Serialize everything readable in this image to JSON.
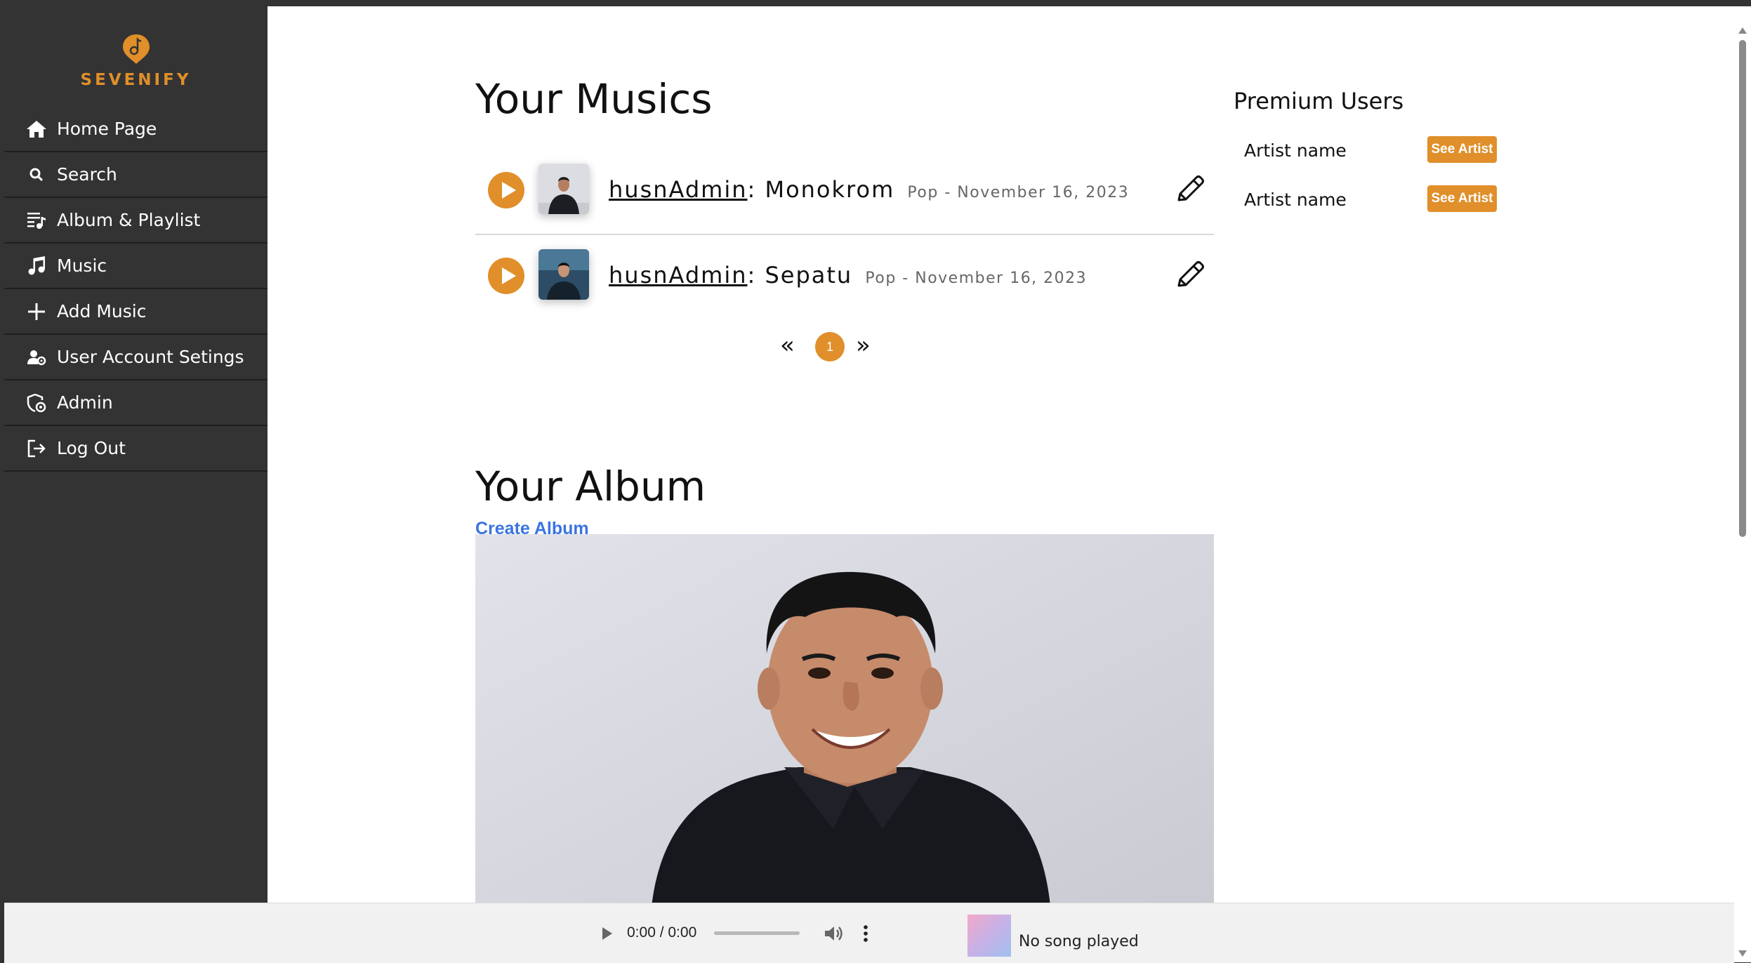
{
  "brand": {
    "name": "SEVENIFY",
    "color": "#E08F2A"
  },
  "sidebar": {
    "items": [
      {
        "label": "Home Page",
        "icon": "home-icon"
      },
      {
        "label": "Search",
        "icon": "search-icon"
      },
      {
        "label": "Album & Playlist",
        "icon": "playlist-icon"
      },
      {
        "label": "Music",
        "icon": "music-note-icon"
      },
      {
        "label": "Add Music",
        "icon": "plus-icon"
      },
      {
        "label": "User Account Setings",
        "icon": "user-gear-icon"
      },
      {
        "label": "Admin",
        "icon": "admin-shield-icon"
      },
      {
        "label": "Log Out",
        "icon": "logout-icon"
      }
    ]
  },
  "musics": {
    "heading": "Your Musics",
    "songs": [
      {
        "user": "husnAdmin",
        "title": "Monokrom",
        "genre": "Pop",
        "separator": "-",
        "date": "November 16, 2023"
      },
      {
        "user": "husnAdmin",
        "title": "Sepatu",
        "genre": "Pop",
        "separator": "-",
        "date": "November 16, 2023"
      }
    ],
    "pagination": {
      "prev": "«",
      "current": "1",
      "next": "»"
    }
  },
  "album": {
    "heading": "Your Album",
    "create_label": "Create Album"
  },
  "premium": {
    "heading": "Premium Users",
    "artists": [
      {
        "name": "Artist name",
        "button": "See Artist"
      },
      {
        "name": "Artist name",
        "button": "See Artist"
      }
    ]
  },
  "player": {
    "time": "0:00 / 0:00",
    "status": "No song played"
  }
}
